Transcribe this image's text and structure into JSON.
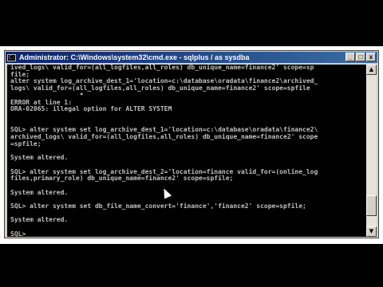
{
  "window": {
    "title": "Administrator: C:\\Windows\\system32\\cmd.exe - sqlplus  / as sysdba",
    "minimize": "_",
    "maximize": "□",
    "close": "x"
  },
  "console": {
    "text": "ived_logs\\ valid_for=(all_logfiles,all_roles) db_unique_name=finance2' scope=sp\nfile;\nalter system log_archive_dest_1='location=c:\\database\\oradata\\finance2\\archived_\nlogs\\ valid_for=(all_logfiles,all_roles) db_unique_name=finance2' scope=spfile\n                  *\nERROR at line 1:\nORA-02065: illegal option for ALTER SYSTEM\n\n\nSQL> alter system set log_archive_dest_1='location=c:\\database\\oradata\\finance2\\\narchived_logs\\ valid_for=(all_logfiles,all_roles) db_unique_name=finance2' scope\n=spfile;\n\nSystem altered.\n\nSQL> alter system set log_archive_dest_2='location=finance valid_for=(online_log\nfiles,primary_role) db_unique_name=finance2' scope=spfile;\n\nSystem altered.\n\nSQL> alter system set db_file_name_convert='finance','finance2' scope=spfile;\n\nSystem altered.\n\nSQL>"
  },
  "scrollbar": {
    "up": "▲",
    "down": "▼"
  }
}
